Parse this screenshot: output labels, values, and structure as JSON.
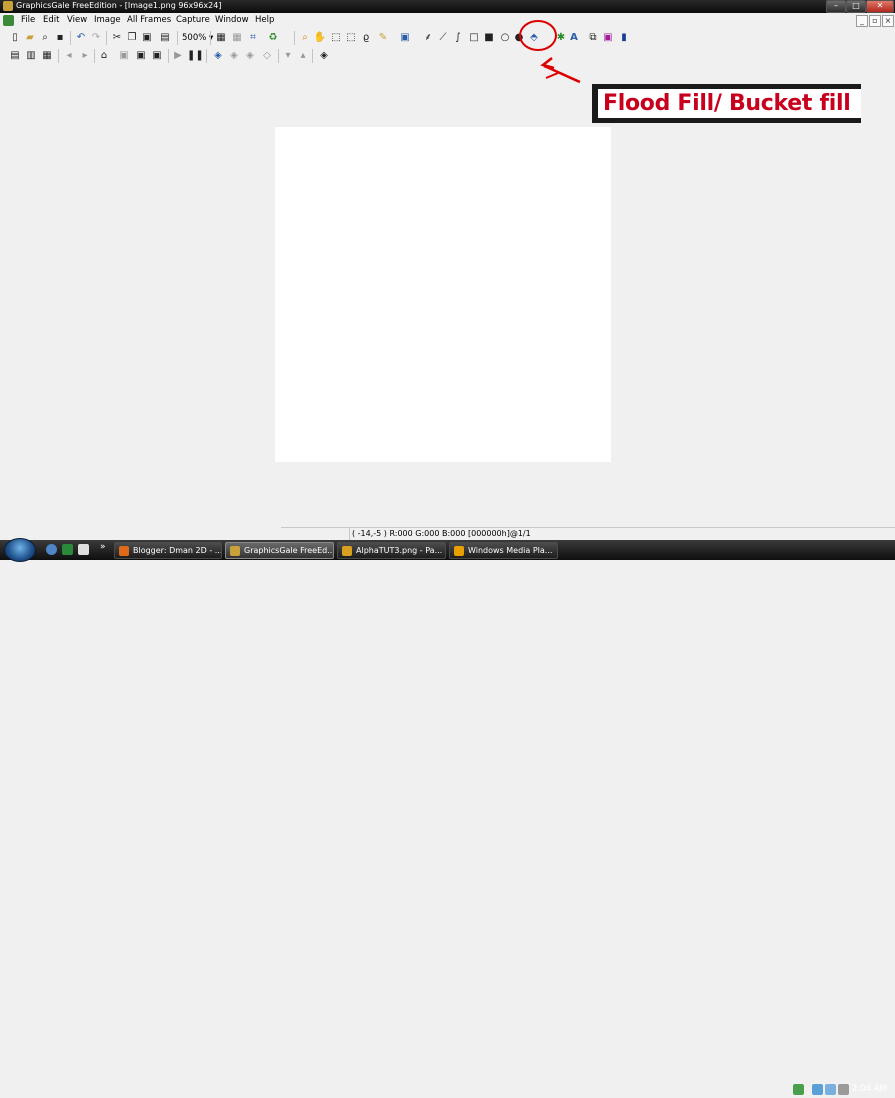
{
  "window": {
    "title": "GraphicsGale FreeEdition - [Image1.png 96x96x24]",
    "controls": {
      "minimize": "–",
      "maximize": "□",
      "close": "✕"
    }
  },
  "menu": [
    "File",
    "Edit",
    "View",
    "Image",
    "All Frames",
    "Capture",
    "Window",
    "Help"
  ],
  "mdi_controls": {
    "minimize": "_",
    "restore": "▫",
    "close": "×"
  },
  "toolbar": {
    "zoom_label": "500%",
    "icons1": [
      "new-file-icon",
      "open-folder-icon",
      "preview-icon",
      "save-icon",
      "undo-icon",
      "redo-icon",
      "cut-icon",
      "copy-icon",
      "paste-icon",
      "paste-new-icon",
      "zoom-dropdown",
      "grid-icon",
      "dot-grid-icon",
      "crop-icon",
      "recycle-icon",
      "magnifier-icon",
      "hand-icon",
      "rect-select-icon",
      "lasso-icon",
      "magic-wand-icon",
      "pencil-icon",
      "color-select-icon",
      "spray-icon",
      "line-icon",
      "curve-icon",
      "rectangle-icon",
      "filled-rectangle-icon",
      "ellipse-icon",
      "filled-ellipse-icon",
      "flood-fill-icon",
      "replace-color-icon",
      "text-icon",
      "copy-frame-icon",
      "frame-icon",
      "brush-icon"
    ],
    "icons2": [
      "frame-list-icon",
      "frame-props-icon",
      "frame-delay-icon",
      "prev-frame-icon",
      "next-frame-icon",
      "home-icon",
      "onion-icon",
      "layer-icon",
      "layer-merge-icon",
      "play-icon",
      "pause-icon",
      "add-layer-icon",
      "delete-layer-icon",
      "layer-hide-icon",
      "layer-lock-icon",
      "move-up-icon",
      "move-down-icon",
      "layer-props-icon"
    ]
  },
  "annotation": {
    "callout_text": "Flood Fill/ Bucket fill",
    "color": "#d00000"
  },
  "statusbar": {
    "info": "( -14,-5 ) R:000 G:000 B:000  [000000h]@1/1"
  },
  "taskbar": {
    "tasks": [
      {
        "label": "Blogger: Dman 2D - ...",
        "active": false,
        "icon_color": "#e06a1a"
      },
      {
        "label": "GraphicsGale FreeEd...",
        "active": true,
        "icon_color": "#c9a13a"
      },
      {
        "label": "AlphaTUT3.png - Pa...",
        "active": false,
        "icon_color": "#d9a020"
      },
      {
        "label": "Windows Media Pla...",
        "active": false,
        "icon_color": "#e8a000"
      }
    ],
    "more": "»",
    "clock": "2:04 AM"
  }
}
